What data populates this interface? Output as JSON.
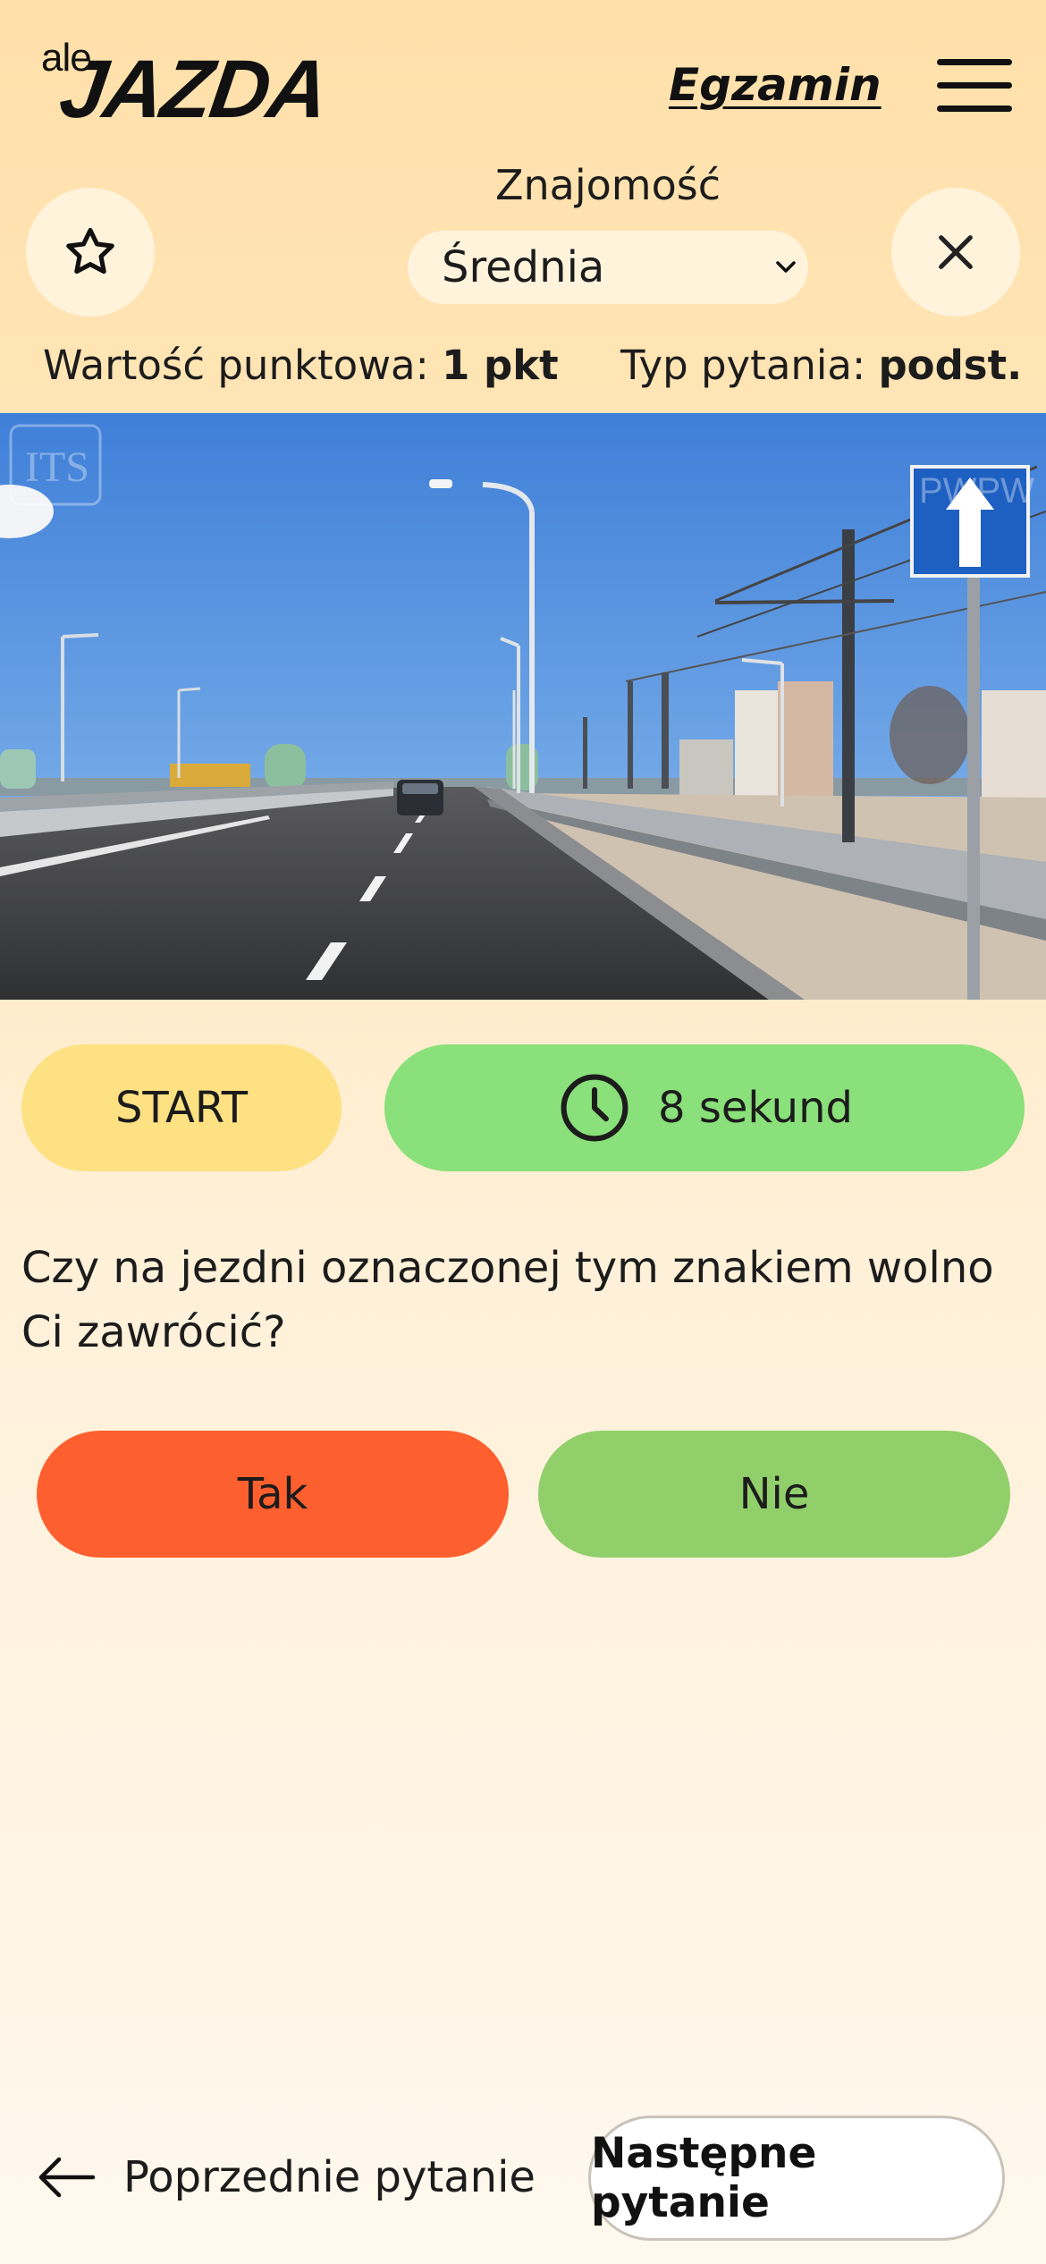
{
  "header": {
    "logo_small": "ale",
    "logo_big": "JAZDA",
    "exam_link": "Egzamin"
  },
  "controls": {
    "familiarity_label": "Znajomość",
    "familiarity_value": "Średnia"
  },
  "meta": {
    "points_label": "Wartość punktowa:",
    "points_value": "1 pkt",
    "type_label": "Typ pytania:",
    "type_value": "podst."
  },
  "photo": {
    "watermark_left": "ITS",
    "watermark_right": "PWPW"
  },
  "timer": {
    "start_label": "START",
    "time_text": "8 sekund"
  },
  "question": {
    "text": "Czy na jezdni oznaczonej tym znakiem wolno Ci zawrócić?"
  },
  "answers": {
    "yes": "Tak",
    "no": "Nie"
  },
  "nav": {
    "prev_label": "Poprzednie pytanie",
    "next_label": "Następne pytanie"
  },
  "colors": {
    "start_button": "#fde182",
    "timer_bar": "#8ae07a",
    "answer_yes": "#fe5f2e",
    "answer_no": "#91cf6b",
    "background_top": "#ffe0aa",
    "background_bottom": "#fff8ee"
  }
}
